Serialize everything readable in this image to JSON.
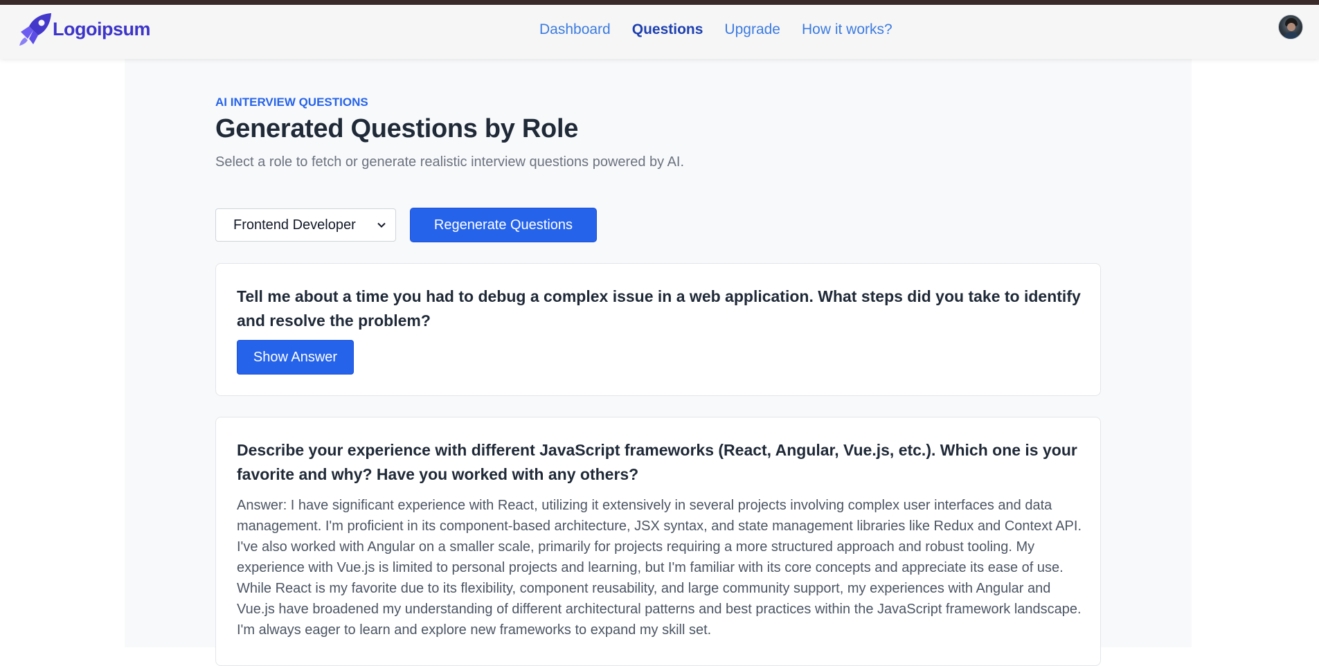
{
  "brand": {
    "name": "Logoipsum"
  },
  "nav": {
    "items": [
      {
        "label": "Dashboard",
        "active": false
      },
      {
        "label": "Questions",
        "active": true
      },
      {
        "label": "Upgrade",
        "active": false
      },
      {
        "label": "How it works?",
        "active": false
      }
    ]
  },
  "header": {
    "eyebrow": "AI INTERVIEW QUESTIONS",
    "title": "Generated Questions by Role",
    "subtitle": "Select a role to fetch or generate realistic interview questions powered by AI."
  },
  "controls": {
    "role_selected": "Frontend Developer",
    "regenerate_label": "Regenerate Questions"
  },
  "questions": [
    {
      "question": "Tell me about a time you had to debug a complex issue in a web application. What steps did you take to identify and resolve the problem?",
      "show_answer_label": "Show Answer"
    },
    {
      "question": "Describe your experience with different JavaScript frameworks (React, Angular, Vue.js, etc.). Which one is your favorite and why? Have you worked with any others?",
      "answer": "Answer: I have significant experience with React, utilizing it extensively in several projects involving complex user interfaces and data management. I'm proficient in its component-based architecture, JSX syntax, and state management libraries like Redux and Context API. I've also worked with Angular on a smaller scale, primarily for projects requiring a more structured approach and robust tooling. My experience with Vue.js is limited to personal projects and learning, but I'm familiar with its core concepts and appreciate its ease of use. While React is my favorite due to its flexibility, component reusability, and large community support, my experiences with Angular and Vue.js have broadened my understanding of different architectural patterns and best practices within the JavaScript framework landscape. I'm always eager to learn and explore new frameworks to expand my skill set."
    }
  ],
  "colors": {
    "primary": "#2563eb",
    "brand": "#3d35c8",
    "nav_link": "#3b7be0",
    "nav_active": "#1e40af"
  },
  "icons": {
    "logo": "rocket-logo-icon",
    "select": "chevron-down-icon",
    "avatar": "user-avatar"
  }
}
